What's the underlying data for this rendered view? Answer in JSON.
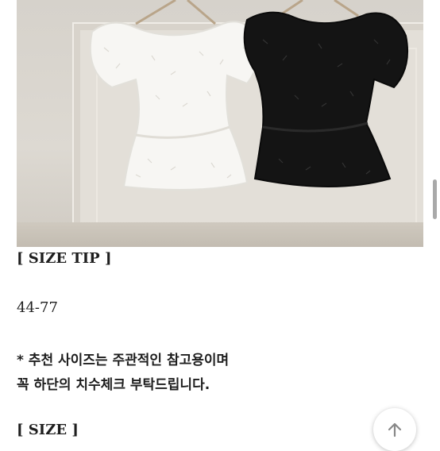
{
  "product_image": {
    "alt": "white and black fringe puff-sleeve blouses on hangers",
    "colors": {
      "white_top": "#f7f6f3",
      "black_top": "#141414",
      "wall": "#ddd9d2"
    }
  },
  "content": {
    "size_tip_heading": "[ SIZE TIP ]",
    "size_range": "44-77",
    "note_line1": "* 추천 사이즈는 주관적인 참고용이며",
    "note_line2": "꼭 하단의 치수체크 부탁드립니다.",
    "size_heading": "[ SIZE ]"
  },
  "controls": {
    "scroll_to_top_icon": "arrow-up-icon"
  }
}
